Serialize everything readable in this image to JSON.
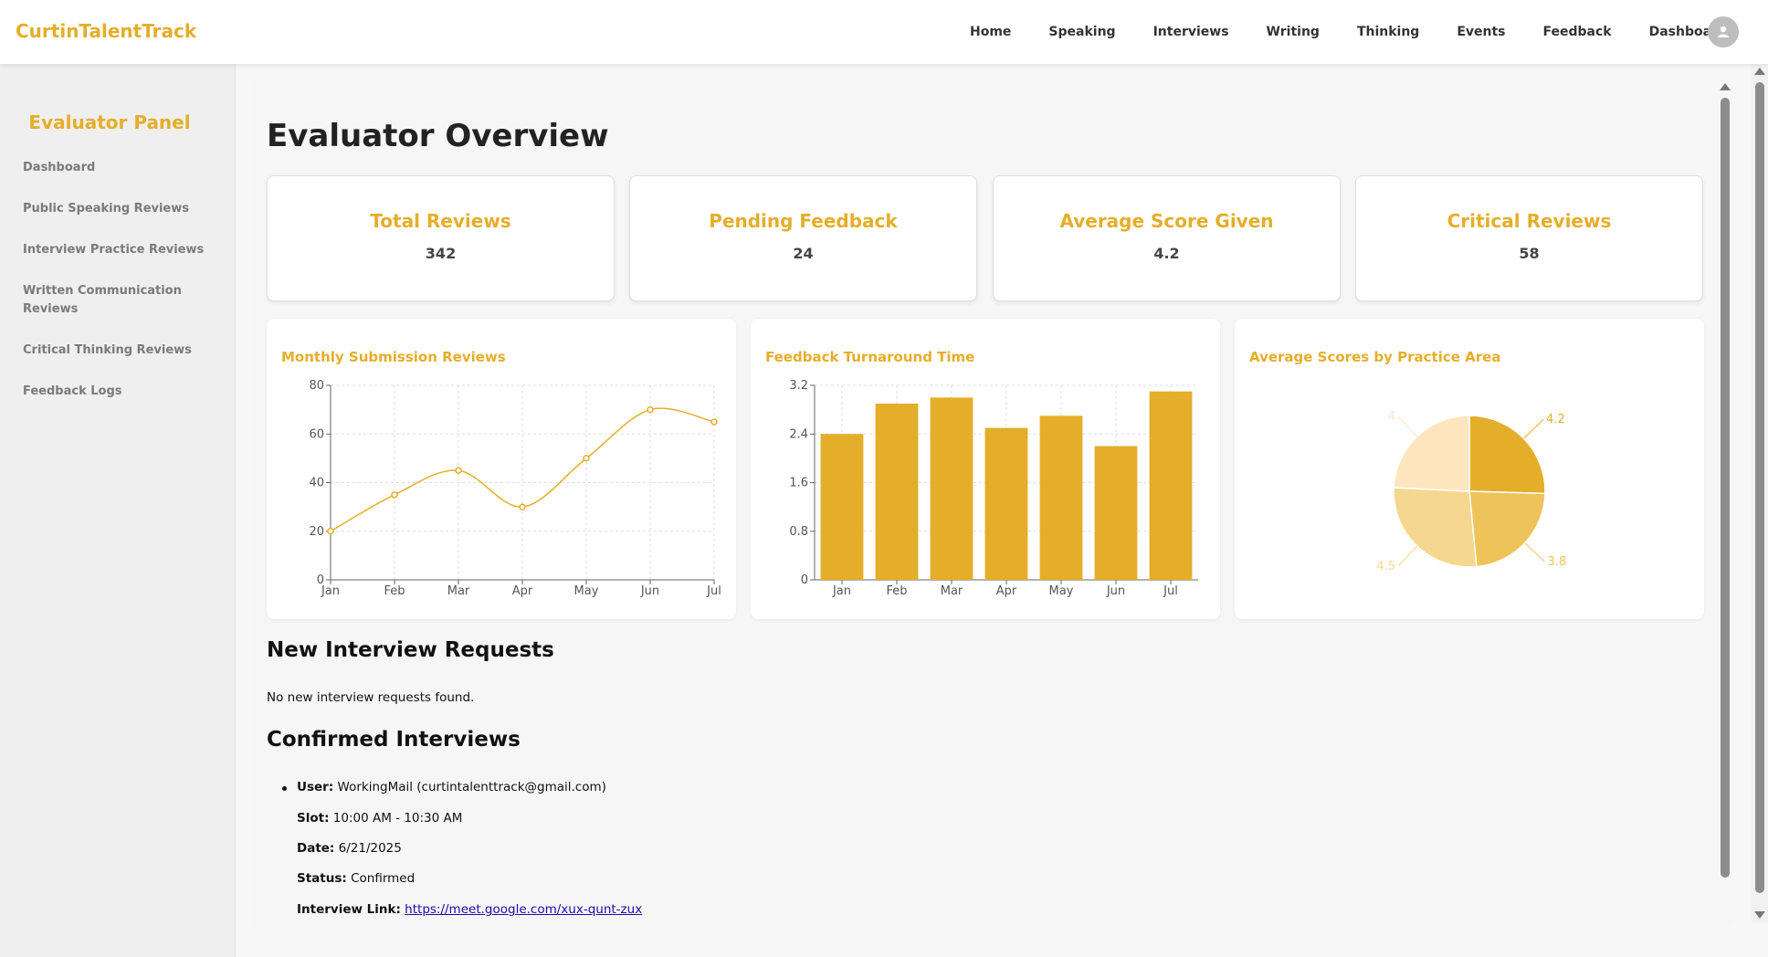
{
  "brand": "CurtinTalentTrack",
  "nav": [
    "Home",
    "Speaking",
    "Interviews",
    "Writing",
    "Thinking",
    "Events",
    "Feedback",
    "Dashboard"
  ],
  "avatar_icon": "user-icon",
  "sidebar": {
    "title": "Evaluator Panel",
    "items": [
      "Dashboard",
      "Public Speaking Reviews",
      "Interview Practice Reviews",
      "Written Communication Reviews",
      "Critical Thinking Reviews",
      "Feedback Logs"
    ]
  },
  "main": {
    "title": "Evaluator Overview",
    "stats": [
      {
        "label": "Total Reviews",
        "value": "342"
      },
      {
        "label": "Pending Feedback",
        "value": "24"
      },
      {
        "label": "Average Score Given",
        "value": "4.2"
      },
      {
        "label": "Critical Reviews",
        "value": "58"
      }
    ],
    "new_requests_title": "New Interview Requests",
    "new_requests_empty": "No new interview requests found.",
    "confirmed_title": "Confirmed Interviews",
    "confirmed": {
      "user_label": "User:",
      "user_value": "WorkingMail (curtintalenttrack@gmail.com)",
      "slot_label": "Slot:",
      "slot_value": "10:00 AM - 10:30 AM",
      "date_label": "Date:",
      "date_value": "6/21/2025",
      "status_label": "Status:",
      "status_value": "Confirmed",
      "link_label": "Interview Link:",
      "link_value": "https://meet.google.com/xux-qunt-zux"
    }
  },
  "colors": {
    "accent": "#e5ae2a",
    "pie": [
      "#e5ae2a",
      "#eec35a",
      "#f6d78f",
      "#fde6be"
    ]
  },
  "chart_data": [
    {
      "type": "line",
      "title": "Monthly Submission Reviews",
      "categories": [
        "Jan",
        "Feb",
        "Mar",
        "Apr",
        "May",
        "Jun",
        "Jul"
      ],
      "values": [
        20,
        35,
        45,
        30,
        50,
        70,
        65
      ],
      "ylim": [
        0,
        80
      ],
      "yticks": [
        "0",
        "20",
        "40",
        "60",
        "80"
      ],
      "grid": true
    },
    {
      "type": "bar",
      "title": "Feedback Turnaround Time",
      "categories": [
        "Jan",
        "Feb",
        "Mar",
        "Apr",
        "May",
        "Jun",
        "Jul"
      ],
      "values": [
        2.4,
        2.9,
        3.0,
        2.5,
        2.7,
        2.2,
        3.1
      ],
      "ylim": [
        0,
        3.2
      ],
      "yticks": [
        "0",
        "0.8",
        "1.6",
        "2.4",
        "3.2"
      ],
      "grid": true
    },
    {
      "type": "pie",
      "title": "Average Scores by Practice Area",
      "values": [
        4.2,
        3.8,
        4.5,
        4
      ],
      "labels": [
        "4.2",
        "3.8",
        "4.5",
        "4"
      ]
    }
  ]
}
